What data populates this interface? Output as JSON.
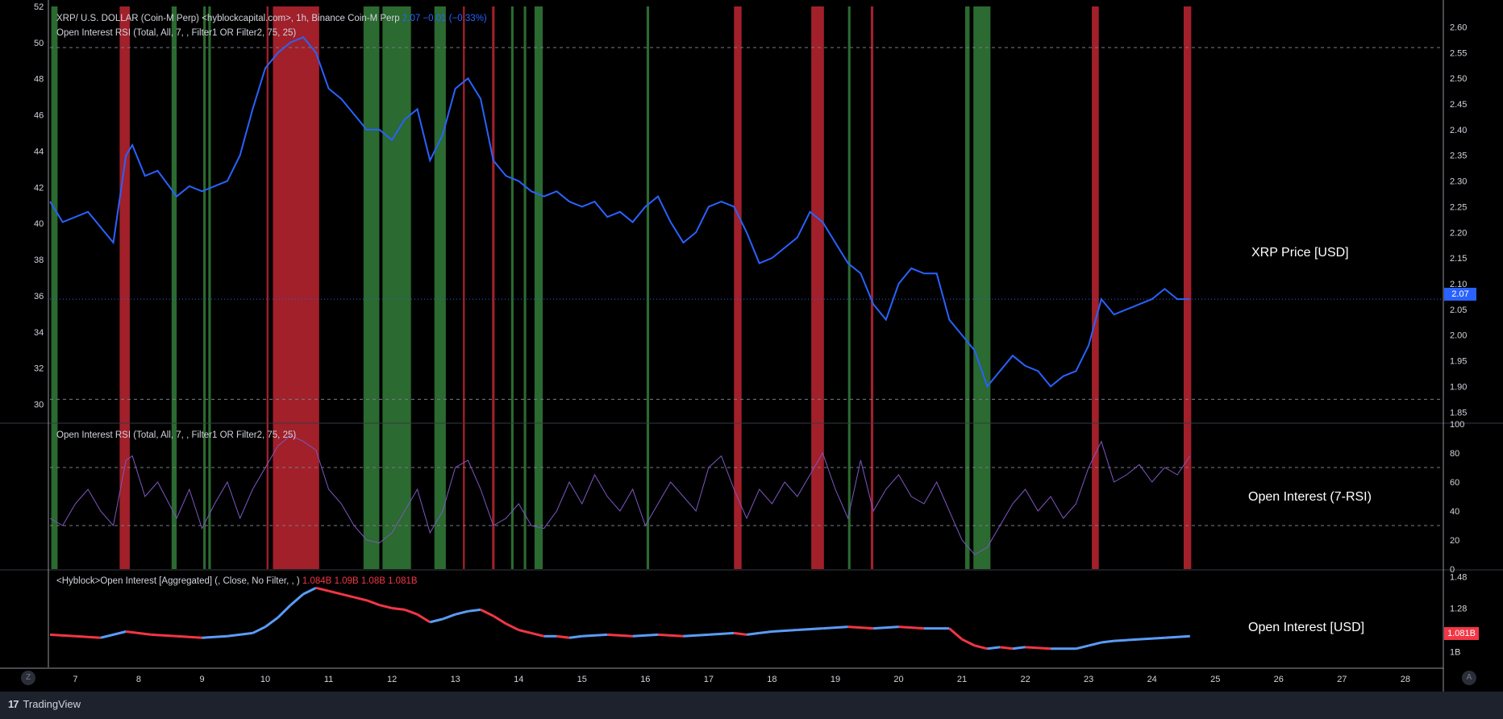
{
  "legend": {
    "main_title": "XRP/  U.S. DOLLAR (Coin-M Perp) <hyblockcapital.com>, 1h, Binance Coin-M Perp",
    "main_value": "2.07",
    "main_change": "−0.01 (−0.33%)",
    "rsi_overlay": "Open Interest RSI (Total, All, 7, , Filter1 OR Filter2, 75, 25)",
    "rsi_pane": "Open Interest RSI (Total, All, 7, , Filter1 OR Filter2, 75, 25)",
    "oi_pane": "<Hyblock>Open Interest [Aggregated] (, Close, No Filter, , )",
    "oi_values": [
      "1.084B",
      "1.09B",
      "1.08B",
      "1.081B"
    ]
  },
  "labels": {
    "price": "XRP Price [USD]",
    "rsi": "Open Interest (7-RSI)",
    "oi": "Open Interest [USD]"
  },
  "price_tag": "2.07",
  "oi_tag": "1.081B",
  "brand": "TradingView",
  "brand_logo": "17",
  "corner_left": "Z",
  "corner_right": "A",
  "colors": {
    "price_line": "#2962ff",
    "rsi_line": "#7e57c2",
    "oi_up": "#5b9cf6",
    "oi_down": "#f23645",
    "green_band": "#2b6a30",
    "red_band": "#a1202a",
    "grid": "#363a45",
    "axis_text": "#d1d4dc"
  },
  "chart_data": {
    "type": "line",
    "x_axis": {
      "unit": "day",
      "range": [
        6.6,
        28.6
      ],
      "ticks": [
        "7",
        "8",
        "9",
        "10",
        "11",
        "12",
        "13",
        "14",
        "15",
        "16",
        "17",
        "18",
        "19",
        "20",
        "21",
        "22",
        "23",
        "24",
        "25",
        "26",
        "27",
        "28"
      ]
    },
    "panes": [
      {
        "name": "price",
        "left_axis": {
          "range": [
            29,
            52
          ],
          "ticks": [
            30,
            32,
            34,
            36,
            38,
            40,
            42,
            44,
            46,
            48,
            50,
            52
          ]
        },
        "right_axis": {
          "range": [
            1.83,
            2.64
          ],
          "ticks": [
            "1.85",
            "1.90",
            "1.95",
            "2.00",
            "2.05",
            "2.10",
            "2.15",
            "2.20",
            "2.25",
            "2.30",
            "2.35",
            "2.40",
            "2.45",
            "2.50",
            "2.55",
            "2.60"
          ]
        },
        "reference_lines": [
          2.56,
          1.875
        ],
        "series": [
          {
            "x": [
              6.6,
              6.8,
              7.0,
              7.2,
              7.4,
              7.6,
              7.8,
              7.9,
              8.1,
              8.3,
              8.6,
              8.8,
              9.0,
              9.2,
              9.4,
              9.6,
              9.8,
              10.0,
              10.2,
              10.4,
              10.6,
              10.8,
              11.0,
              11.2,
              11.4,
              11.6,
              11.8,
              12.0,
              12.2,
              12.4,
              12.6,
              12.8,
              13.0,
              13.2,
              13.4,
              13.6,
              13.8,
              14.0,
              14.2,
              14.4,
              14.6,
              14.8,
              15.0,
              15.2,
              15.4,
              15.6,
              15.8,
              16.0,
              16.2,
              16.4,
              16.6,
              16.8,
              17.0,
              17.2,
              17.4,
              17.6,
              17.8,
              18.0,
              18.2,
              18.4,
              18.6,
              18.8,
              19.0,
              19.2,
              19.4,
              19.6,
              19.8,
              20.0,
              20.2,
              20.4,
              20.6,
              20.8,
              21.0,
              21.2,
              21.4,
              21.6,
              21.8,
              22.0,
              22.2,
              22.4,
              22.6,
              22.8,
              23.0,
              23.2,
              23.4,
              23.6,
              23.8,
              24.0,
              24.2,
              24.4,
              24.6
            ],
            "y": [
              2.26,
              2.22,
              2.23,
              2.24,
              2.21,
              2.18,
              2.35,
              2.37,
              2.31,
              2.32,
              2.27,
              2.29,
              2.28,
              2.29,
              2.3,
              2.35,
              2.44,
              2.52,
              2.55,
              2.57,
              2.58,
              2.55,
              2.48,
              2.46,
              2.43,
              2.4,
              2.4,
              2.38,
              2.42,
              2.44,
              2.34,
              2.39,
              2.48,
              2.5,
              2.46,
              2.34,
              2.31,
              2.3,
              2.28,
              2.27,
              2.28,
              2.26,
              2.25,
              2.26,
              2.23,
              2.24,
              2.22,
              2.25,
              2.27,
              2.22,
              2.18,
              2.2,
              2.25,
              2.26,
              2.25,
              2.2,
              2.14,
              2.15,
              2.17,
              2.19,
              2.24,
              2.22,
              2.18,
              2.14,
              2.12,
              2.06,
              2.03,
              2.1,
              2.13,
              2.12,
              2.12,
              2.03,
              2.0,
              1.97,
              1.9,
              1.93,
              1.96,
              1.94,
              1.93,
              1.9,
              1.92,
              1.93,
              1.98,
              2.07,
              2.04,
              2.05,
              2.06,
              2.07,
              2.09,
              2.07,
              2.07
            ]
          }
        ]
      },
      {
        "name": "rsi",
        "right_axis": {
          "range": [
            0,
            100
          ],
          "ticks": [
            0,
            20,
            40,
            60,
            80,
            100
          ]
        },
        "reference_lines": [
          70,
          30
        ],
        "series": [
          {
            "x": [
              6.6,
              6.8,
              7.0,
              7.2,
              7.4,
              7.6,
              7.8,
              7.9,
              8.1,
              8.3,
              8.6,
              8.8,
              9.0,
              9.2,
              9.4,
              9.6,
              9.8,
              10.0,
              10.2,
              10.4,
              10.6,
              10.8,
              11.0,
              11.2,
              11.4,
              11.6,
              11.8,
              12.0,
              12.2,
              12.4,
              12.6,
              12.8,
              13.0,
              13.2,
              13.4,
              13.6,
              13.8,
              14.0,
              14.2,
              14.4,
              14.6,
              14.8,
              15.0,
              15.2,
              15.4,
              15.6,
              15.8,
              16.0,
              16.2,
              16.4,
              16.6,
              16.8,
              17.0,
              17.2,
              17.4,
              17.6,
              17.8,
              18.0,
              18.2,
              18.4,
              18.6,
              18.8,
              19.0,
              19.2,
              19.4,
              19.6,
              19.8,
              20.0,
              20.2,
              20.4,
              20.6,
              20.8,
              21.0,
              21.2,
              21.4,
              21.6,
              21.8,
              22.0,
              22.2,
              22.4,
              22.6,
              22.8,
              23.0,
              23.2,
              23.4,
              23.6,
              23.8,
              24.0,
              24.2,
              24.4,
              24.6
            ],
            "y": [
              35,
              30,
              45,
              55,
              40,
              30,
              75,
              78,
              50,
              60,
              35,
              55,
              28,
              45,
              60,
              35,
              55,
              70,
              85,
              92,
              88,
              82,
              55,
              45,
              30,
              20,
              18,
              25,
              40,
              55,
              25,
              40,
              70,
              75,
              55,
              30,
              35,
              45,
              30,
              28,
              40,
              60,
              45,
              65,
              50,
              40,
              55,
              30,
              45,
              60,
              50,
              40,
              70,
              78,
              55,
              35,
              55,
              45,
              60,
              50,
              65,
              80,
              55,
              35,
              75,
              40,
              55,
              65,
              50,
              45,
              60,
              40,
              20,
              10,
              15,
              30,
              45,
              55,
              40,
              50,
              35,
              45,
              70,
              88,
              60,
              65,
              72,
              60,
              70,
              65,
              78
            ]
          }
        ]
      },
      {
        "name": "open_interest",
        "right_axis": {
          "range": [
            0.9,
            1.52
          ],
          "ticks": [
            "1B",
            "1.28",
            "1.48"
          ]
        },
        "series": [
          {
            "x": [
              6.6,
              7.0,
              7.4,
              7.8,
              8.2,
              8.6,
              9.0,
              9.4,
              9.8,
              10.0,
              10.2,
              10.4,
              10.6,
              10.8,
              11.0,
              11.2,
              11.4,
              11.6,
              11.8,
              12.0,
              12.2,
              12.4,
              12.6,
              12.8,
              13.0,
              13.2,
              13.4,
              13.6,
              13.8,
              14.0,
              14.2,
              14.4,
              14.6,
              14.8,
              15.0,
              15.4,
              15.8,
              16.2,
              16.6,
              17.0,
              17.4,
              17.6,
              17.8,
              18.0,
              18.4,
              18.8,
              19.2,
              19.6,
              20.0,
              20.4,
              20.8,
              21.0,
              21.2,
              21.4,
              21.6,
              21.8,
              22.0,
              22.4,
              22.8,
              23.0,
              23.2,
              23.4,
              23.8,
              24.2,
              24.6
            ],
            "y": [
              1.11,
              1.1,
              1.09,
              1.13,
              1.11,
              1.1,
              1.09,
              1.1,
              1.12,
              1.16,
              1.22,
              1.3,
              1.37,
              1.41,
              1.39,
              1.37,
              1.35,
              1.33,
              1.3,
              1.28,
              1.27,
              1.24,
              1.19,
              1.21,
              1.24,
              1.26,
              1.27,
              1.23,
              1.18,
              1.14,
              1.12,
              1.1,
              1.1,
              1.09,
              1.1,
              1.11,
              1.1,
              1.11,
              1.1,
              1.11,
              1.12,
              1.11,
              1.12,
              1.13,
              1.14,
              1.15,
              1.16,
              1.15,
              1.16,
              1.15,
              1.15,
              1.08,
              1.04,
              1.02,
              1.03,
              1.02,
              1.03,
              1.02,
              1.02,
              1.04,
              1.06,
              1.07,
              1.08,
              1.09,
              1.1
            ]
          }
        ]
      }
    ],
    "signal_bands": {
      "green": [
        [
          6.62,
          6.72
        ],
        [
          8.52,
          8.6
        ],
        [
          9.02,
          9.06
        ],
        [
          9.1,
          9.14
        ],
        [
          11.55,
          11.8
        ],
        [
          11.85,
          12.3
        ],
        [
          12.67,
          12.85
        ],
        [
          13.88,
          13.92
        ],
        [
          14.08,
          14.12
        ],
        [
          14.25,
          14.38
        ],
        [
          16.02,
          16.06
        ],
        [
          19.2,
          19.24
        ],
        [
          21.05,
          21.12
        ],
        [
          21.18,
          21.45
        ]
      ],
      "red": [
        [
          7.7,
          7.86
        ],
        [
          10.02,
          10.05
        ],
        [
          10.12,
          10.85
        ],
        [
          13.12,
          13.15
        ],
        [
          13.58,
          13.62
        ],
        [
          17.4,
          17.52
        ],
        [
          18.62,
          18.82
        ],
        [
          19.56,
          19.6
        ],
        [
          23.05,
          23.16
        ],
        [
          24.5,
          24.62
        ]
      ]
    }
  }
}
